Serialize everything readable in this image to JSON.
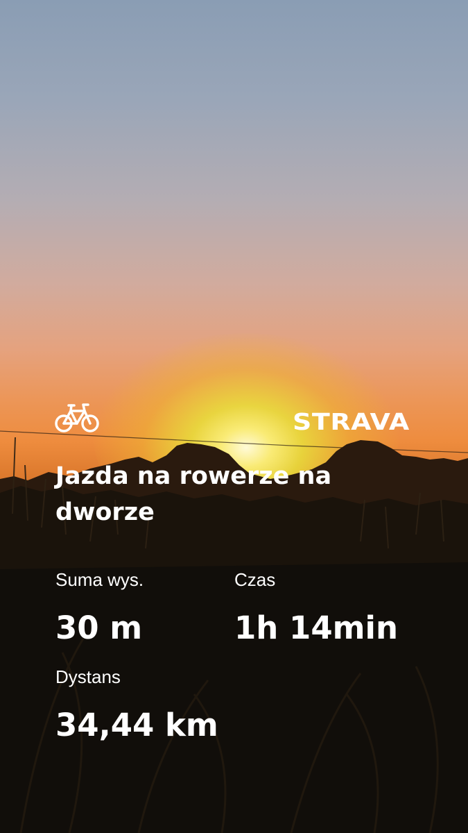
{
  "brand": {
    "name": "STRAVA",
    "color": "#ffffff"
  },
  "activity": {
    "type_icon": "bike-icon",
    "title": "Jazda na rowerze na dworze"
  },
  "stats": {
    "elevation": {
      "label": "Suma wys.",
      "value": "30 m"
    },
    "time": {
      "label": "Czas",
      "value": "1h 14min"
    },
    "distance": {
      "label": "Dystans",
      "value": "34,44 km"
    }
  },
  "photo": {
    "subject": "sunset-over-field",
    "colors": {
      "sky_top": "#8a9db4",
      "sky_orange": "#ee8c3e",
      "sun": "#f5ee7a",
      "ground": "#0d0b08"
    }
  }
}
